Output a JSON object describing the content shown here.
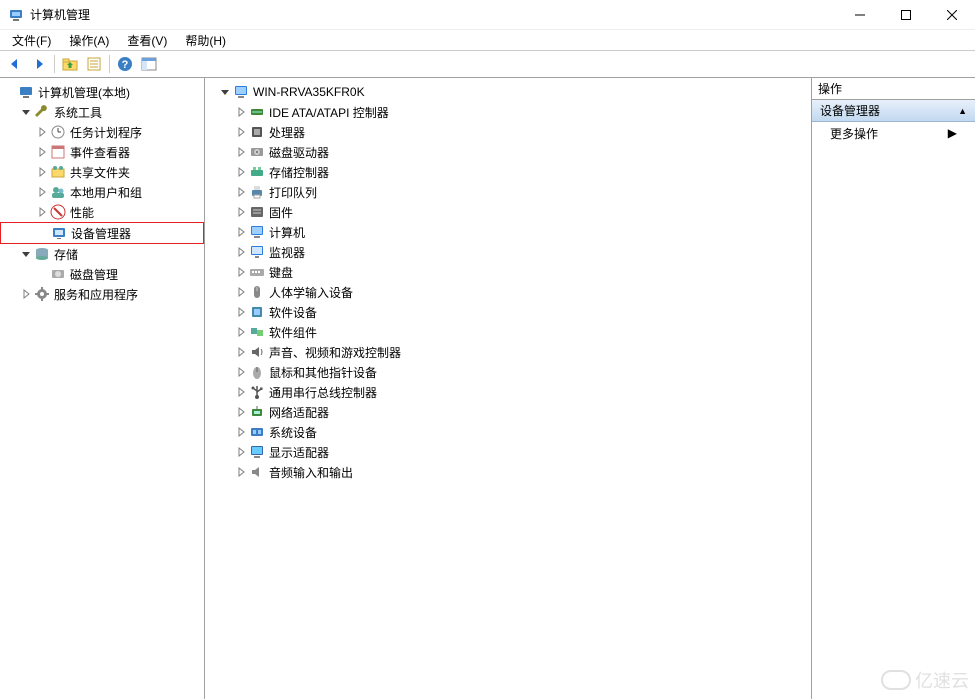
{
  "window": {
    "title": "计算机管理"
  },
  "menubar": [
    "文件(F)",
    "操作(A)",
    "查看(V)",
    "帮助(H)"
  ],
  "toolbar": {
    "back": "back-icon",
    "forward": "forward-icon",
    "up": "up-folder-icon",
    "props": "properties-icon",
    "help": "help-icon",
    "show": "show-pane-icon"
  },
  "leftTree": [
    {
      "lvl": 0,
      "tw": "none",
      "icon": "computer-mgmt",
      "label": "计算机管理(本地)"
    },
    {
      "lvl": 1,
      "tw": "open",
      "icon": "wrench",
      "label": "系统工具"
    },
    {
      "lvl": 2,
      "tw": "closed",
      "icon": "clock",
      "label": "任务计划程序"
    },
    {
      "lvl": 2,
      "tw": "closed",
      "icon": "event",
      "label": "事件查看器"
    },
    {
      "lvl": 2,
      "tw": "closed",
      "icon": "share",
      "label": "共享文件夹"
    },
    {
      "lvl": 2,
      "tw": "closed",
      "icon": "users",
      "label": "本地用户和组"
    },
    {
      "lvl": 2,
      "tw": "closed",
      "icon": "perf",
      "label": "性能"
    },
    {
      "lvl": 2,
      "tw": "none",
      "icon": "device",
      "label": "设备管理器",
      "selected": true
    },
    {
      "lvl": 1,
      "tw": "open",
      "icon": "storage",
      "label": "存储"
    },
    {
      "lvl": 2,
      "tw": "none",
      "icon": "disk",
      "label": "磁盘管理"
    },
    {
      "lvl": 1,
      "tw": "closed",
      "icon": "services",
      "label": "服务和应用程序"
    }
  ],
  "middleTree": [
    {
      "lvl": 0,
      "tw": "open",
      "icon": "pc",
      "label": "WIN-RRVA35KFR0K"
    },
    {
      "lvl": 1,
      "tw": "closed",
      "icon": "ide",
      "label": "IDE ATA/ATAPI 控制器"
    },
    {
      "lvl": 1,
      "tw": "closed",
      "icon": "cpu",
      "label": "处理器"
    },
    {
      "lvl": 1,
      "tw": "closed",
      "icon": "hdd",
      "label": "磁盘驱动器"
    },
    {
      "lvl": 1,
      "tw": "closed",
      "icon": "storage-ctl",
      "label": "存储控制器"
    },
    {
      "lvl": 1,
      "tw": "closed",
      "icon": "printer",
      "label": "打印队列"
    },
    {
      "lvl": 1,
      "tw": "closed",
      "icon": "firmware",
      "label": "固件"
    },
    {
      "lvl": 1,
      "tw": "closed",
      "icon": "pc",
      "label": "计算机"
    },
    {
      "lvl": 1,
      "tw": "closed",
      "icon": "monitor",
      "label": "监视器"
    },
    {
      "lvl": 1,
      "tw": "closed",
      "icon": "keyboard",
      "label": "键盘"
    },
    {
      "lvl": 1,
      "tw": "closed",
      "icon": "hid",
      "label": "人体学输入设备"
    },
    {
      "lvl": 1,
      "tw": "closed",
      "icon": "sw-device",
      "label": "软件设备"
    },
    {
      "lvl": 1,
      "tw": "closed",
      "icon": "sw-comp",
      "label": "软件组件"
    },
    {
      "lvl": 1,
      "tw": "closed",
      "icon": "audio-ctl",
      "label": "声音、视频和游戏控制器"
    },
    {
      "lvl": 1,
      "tw": "closed",
      "icon": "mouse",
      "label": "鼠标和其他指针设备"
    },
    {
      "lvl": 1,
      "tw": "closed",
      "icon": "usb",
      "label": "通用串行总线控制器"
    },
    {
      "lvl": 1,
      "tw": "closed",
      "icon": "network",
      "label": "网络适配器"
    },
    {
      "lvl": 1,
      "tw": "closed",
      "icon": "system",
      "label": "系统设备"
    },
    {
      "lvl": 1,
      "tw": "closed",
      "icon": "display",
      "label": "显示适配器"
    },
    {
      "lvl": 1,
      "tw": "closed",
      "icon": "audio-io",
      "label": "音频输入和输出"
    }
  ],
  "rightPane": {
    "header": "操作",
    "section": "设备管理器",
    "action": "更多操作"
  },
  "watermark": "亿速云"
}
